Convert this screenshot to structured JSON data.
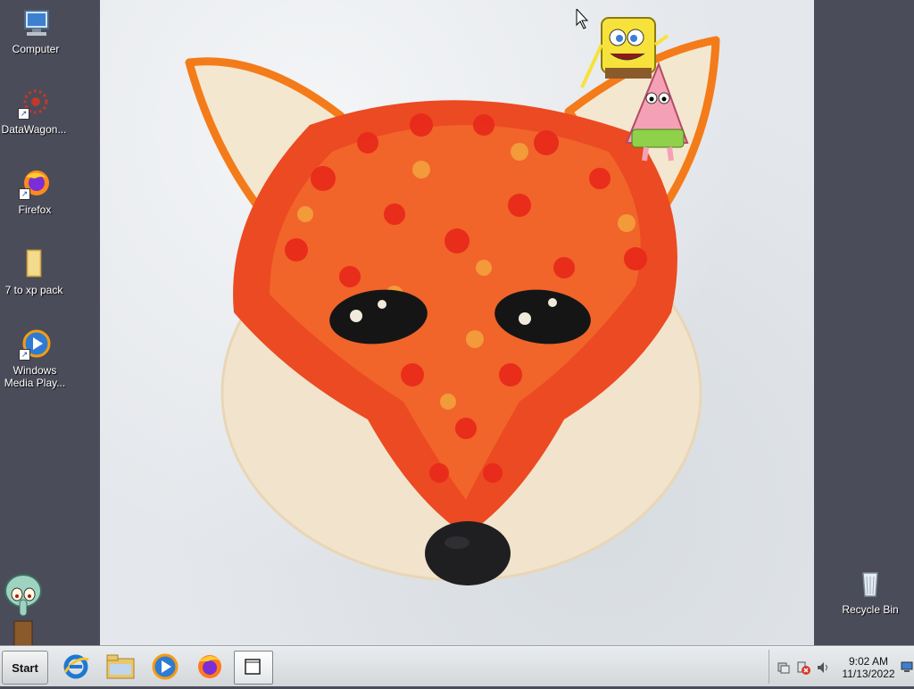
{
  "desktop": {
    "icons": [
      {
        "label": "Computer",
        "icon": "computer-icon"
      },
      {
        "label": "DataWagon...",
        "icon": "datawagon-icon"
      },
      {
        "label": "Firefox",
        "icon": "firefox-icon"
      },
      {
        "label": "7 to xp pack",
        "icon": "folder-icon"
      },
      {
        "label": "Windows Media Play...",
        "icon": "media-player-icon"
      },
      {
        "label": "Recycle Bin",
        "icon": "recycle-bin-icon"
      }
    ]
  },
  "taskbar": {
    "start_label": "Start",
    "pinned": [
      {
        "name": "internet-explorer",
        "icon": "internet-explorer-icon"
      },
      {
        "name": "file-explorer",
        "icon": "folder-icon"
      },
      {
        "name": "media-player",
        "icon": "media-player-icon"
      },
      {
        "name": "firefox",
        "icon": "firefox-icon"
      },
      {
        "name": "window",
        "icon": "window-icon",
        "active": true
      }
    ],
    "tray": {
      "time": "9:02 AM",
      "date": "11/13/2022",
      "icons": [
        "action-center-icon",
        "network-disconnected-icon",
        "volume-icon"
      ]
    }
  },
  "colors": {
    "desktop_bg": "#4b4c5a",
    "fox_orange": "#f26a2e",
    "fox_red": "#e23a1e",
    "cream": "#f3e6cf"
  }
}
